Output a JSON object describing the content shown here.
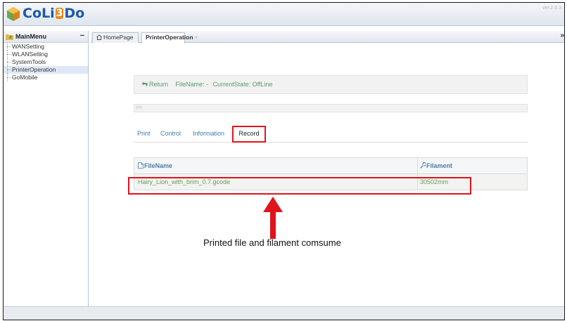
{
  "app": {
    "brand_pre": "CoLi",
    "brand_mid": "3",
    "brand_post": "Do",
    "version": "ver.2.0.3"
  },
  "sidebar": {
    "title": "MainMenu",
    "collapse_label": "−",
    "items": [
      {
        "label": "WANSetting"
      },
      {
        "label": "WLANSetting"
      },
      {
        "label": "SystemTools"
      },
      {
        "label": "PrinterOperation"
      },
      {
        "label": "GoMobile"
      }
    ]
  },
  "tabs": {
    "home": "HomePage",
    "active": "PrinterOperation",
    "close": "×",
    "scroll": "»"
  },
  "status": {
    "return_label": "Return",
    "filename": "FileName: -",
    "state": "CurrentState: OffLine"
  },
  "progress": {
    "label": "0%",
    "fraction": 0
  },
  "subtabs": {
    "print": "Print",
    "control": "Control",
    "information": "Information",
    "record": "Record"
  },
  "table": {
    "headers": {
      "file": "FileName",
      "filament": "Filament"
    },
    "rows": [
      {
        "file": "Hairy_Lion_with_brim_0.7.gcode",
        "filament": "30502mm"
      }
    ]
  },
  "annotation": {
    "text": "Printed file and filament comsume"
  },
  "colors": {
    "highlight": "#e0141b",
    "brand": "#1e5aa8",
    "accent": "#e98a1d"
  },
  "icons": [
    "colido-logo",
    "main-menu-icon",
    "home-icon",
    "return-arrow-icon",
    "document-icon",
    "wrench-icon"
  ]
}
